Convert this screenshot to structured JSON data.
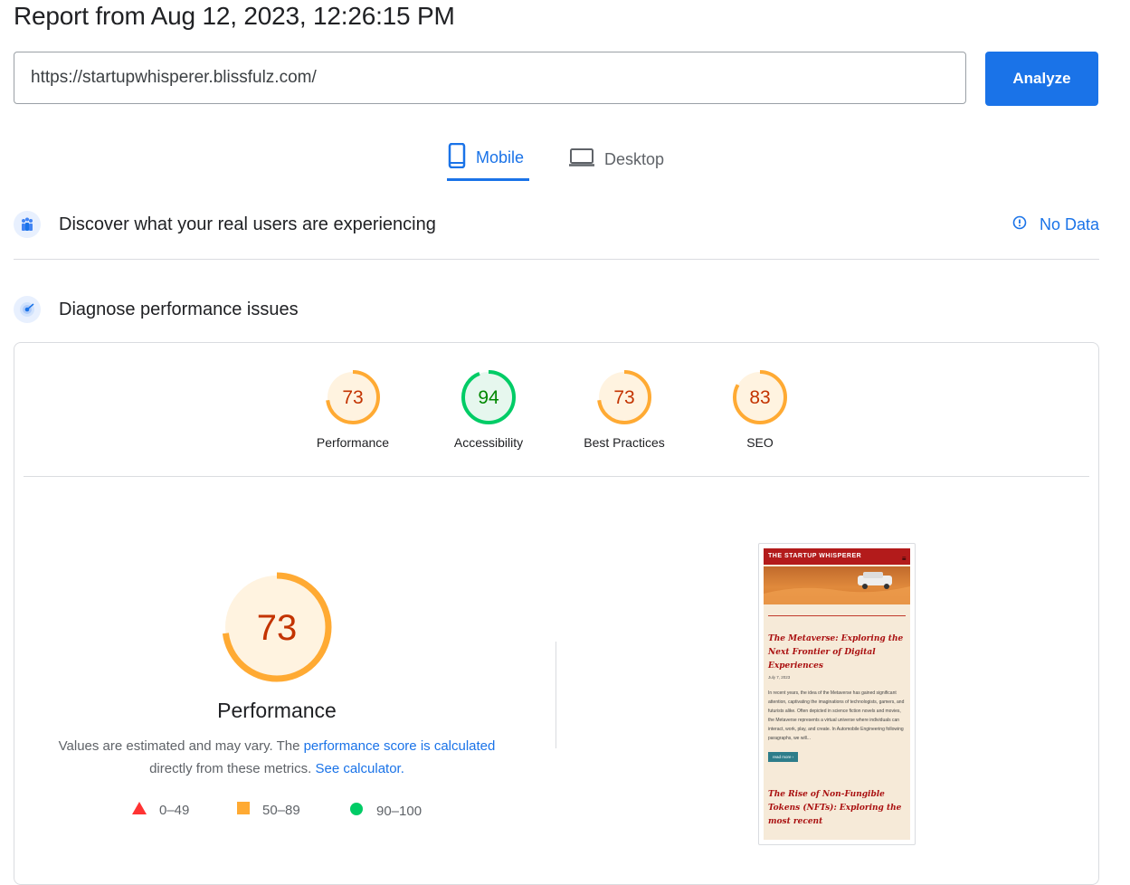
{
  "header": {
    "title": "Report from Aug 12, 2023, 12:26:15 PM"
  },
  "search": {
    "url_value": "https://startupwhisperer.blissfulz.com/",
    "analyze_label": "Analyze"
  },
  "tabs": [
    {
      "label": "Mobile",
      "active": true
    },
    {
      "label": "Desktop",
      "active": false
    }
  ],
  "field_data": {
    "heading": "Discover what your real users are experiencing",
    "status_label": "No Data"
  },
  "diagnose": {
    "heading": "Diagnose performance issues"
  },
  "scores": [
    {
      "label": "Performance",
      "value": 73,
      "color": "#fa3"
    },
    {
      "label": "Accessibility",
      "value": 94,
      "color": "#0c6"
    },
    {
      "label": "Best Practices",
      "value": 73,
      "color": "#fa3"
    },
    {
      "label": "SEO",
      "value": 83,
      "color": "#fa3"
    }
  ],
  "performance": {
    "score": 73,
    "title": "Performance",
    "desc_prefix": "Values are estimated and may vary. The ",
    "desc_link1": "performance score is calculated",
    "desc_middle": "directly from these metrics. ",
    "desc_link2": "See calculator.",
    "legend": [
      {
        "range": "0–49",
        "color": "#f33"
      },
      {
        "range": "50–89",
        "color": "#fa3"
      },
      {
        "range": "90–100",
        "color": "#0c6"
      }
    ]
  },
  "screenshot": {
    "site_name": "THE STARTUP WHISPERER",
    "menu_glyph": "≡",
    "post_title": "The Metaverse: Exploring the Next Frontier of Digital Experiences",
    "post_date": "July 7, 2023",
    "post_excerpt": "In recent years, the idea of the Metaverse has gained significant attention, captivating the imaginations of technologists, gamers, and futurists alike. Often depicted in science fiction novels and movies, the Metaverse represents a virtual universe where individuals can interact, work, play, and create. In Automobile Engineering following paragraphs, we will...",
    "read_more": "read more ›",
    "next_title": "The Rise of Non-Fungible Tokens (NFTs): Exploring the most recent"
  }
}
